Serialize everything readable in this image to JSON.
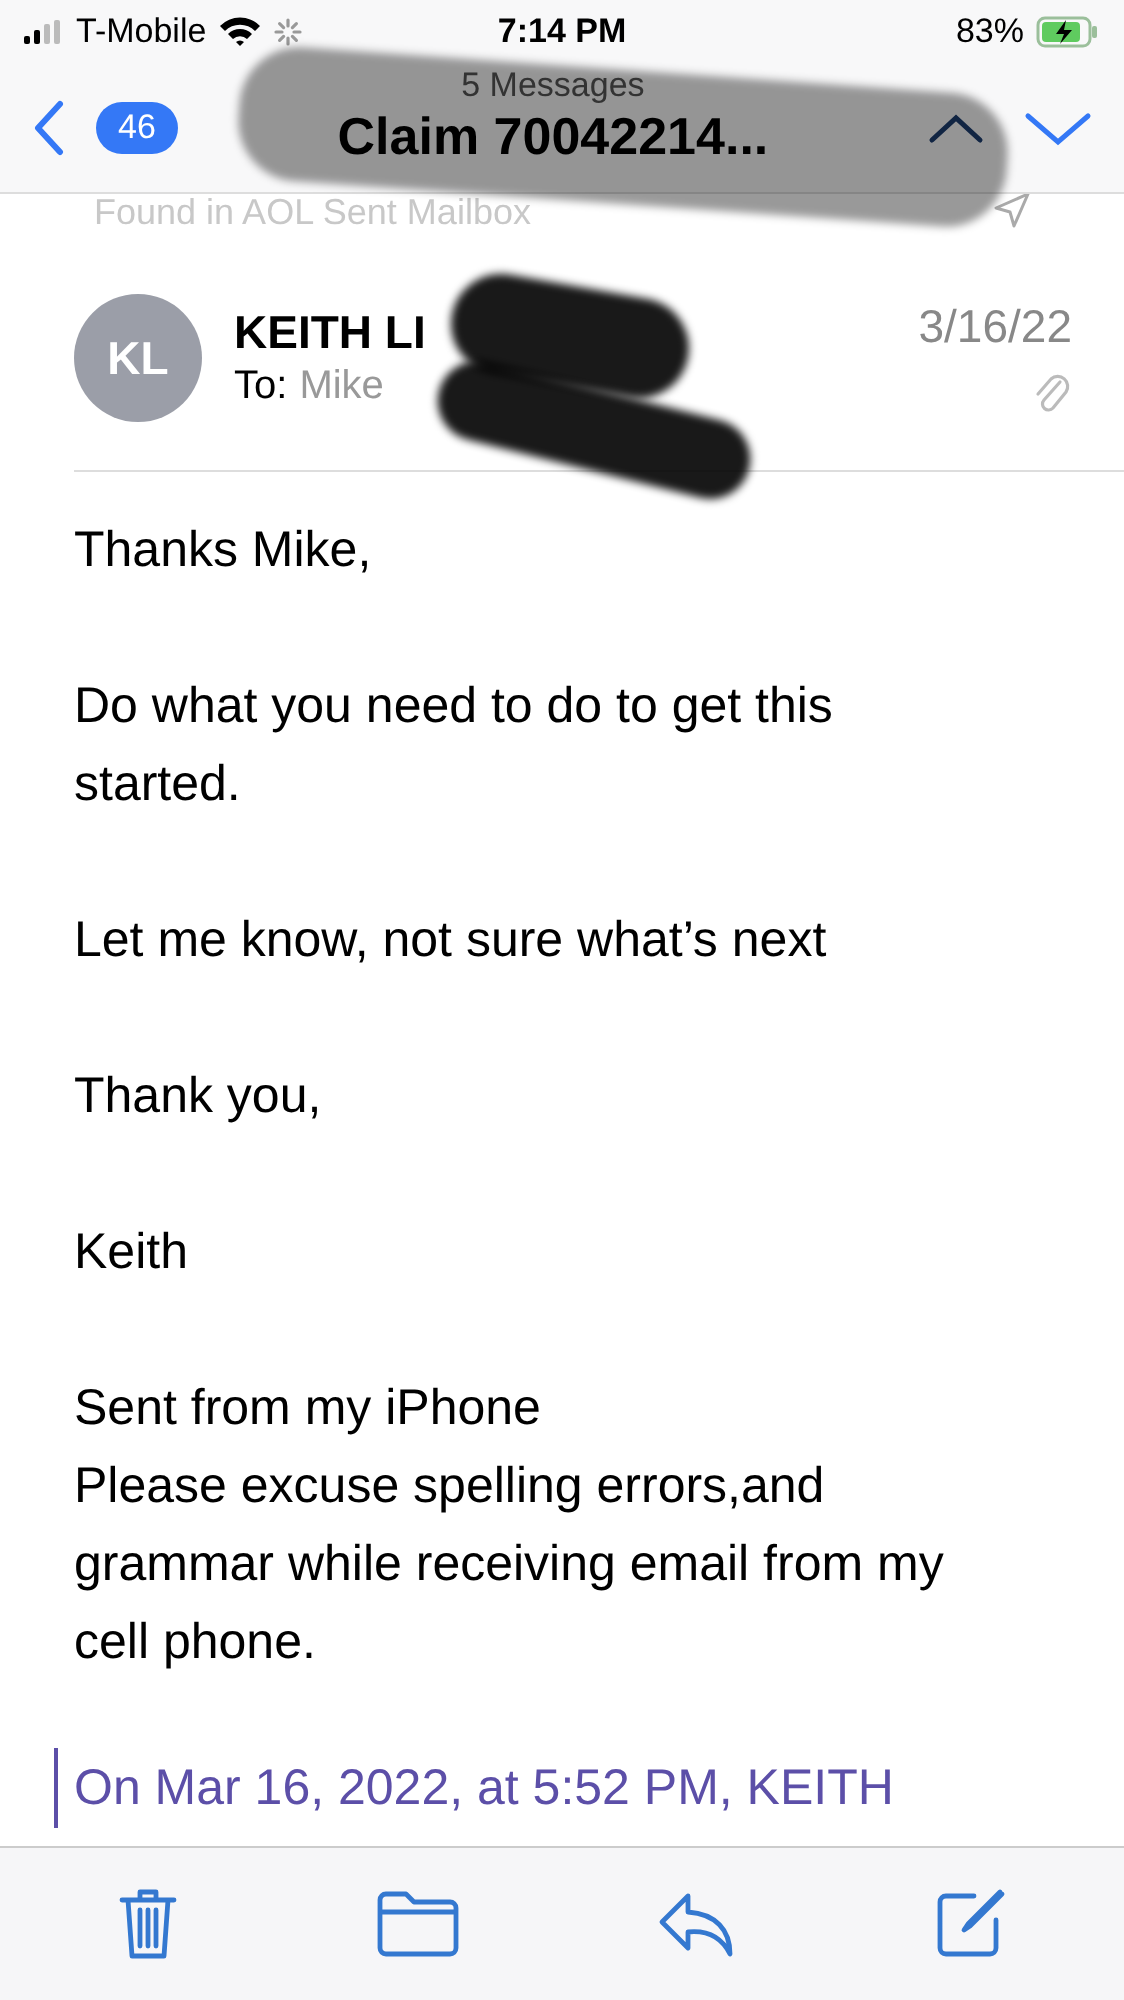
{
  "status_bar": {
    "carrier": "T-Mobile",
    "time": "7:14 PM",
    "battery": "83%"
  },
  "nav": {
    "unread_count": "46",
    "subtitle": "5 Messages",
    "title": "Claim 70042214..."
  },
  "mailbox_note": "Found in AOL Sent Mailbox",
  "message": {
    "avatar": "KL",
    "sender": "KEITH LI",
    "to_label": "To:",
    "recipient": "Mike",
    "date": "3/16/22",
    "has_attachment": true,
    "paragraphs": [
      [
        "Thanks Mike,"
      ],
      [
        "Do what you need to do to get this started."
      ],
      [
        "Let me know, not sure what’s next"
      ],
      [
        "Thank you,"
      ],
      [
        "Keith"
      ],
      [
        "Sent from my iPhone",
        "Please excuse spelling errors,and grammar while receiving email from my cell phone."
      ]
    ],
    "quote": "On Mar 16, 2022, at 5:52 PM, KEITH"
  }
}
